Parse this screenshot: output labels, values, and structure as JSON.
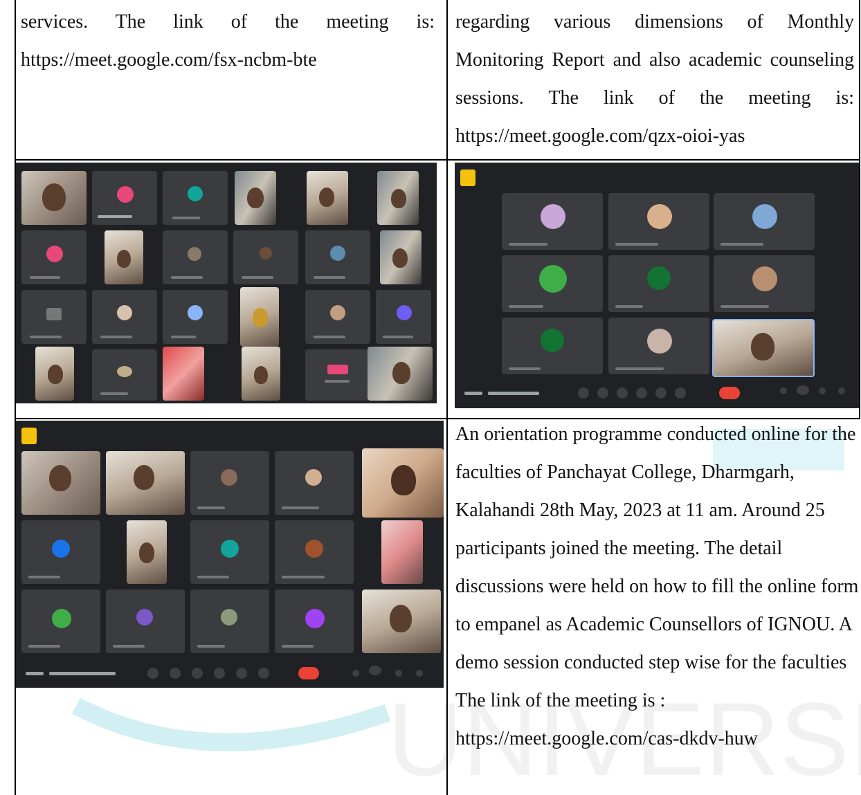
{
  "rows": [
    {
      "left_text": "services. The link of the meeting is: https://meet.google.com/fsx-ncbm-bte",
      "right_text": "regarding various dimensions of Monthly Monitoring Report and also academic counseling sessions. The link of the meeting is: https://meet.google.com/qzx-oioi-yas"
    },
    {
      "left_image": "meeting-screenshot-grid-24-participants",
      "right_image": "meeting-screenshot-grid-9-participants"
    },
    {
      "left_image": "meeting-screenshot-grid-15-participants",
      "right_text": "An orientation programme conducted online for the faculties of Panchayat College, Dharmgarh, Kalahandi 28th May, 2023 at 11 am. Around 25 participants joined the meeting. The detail discussions were held on how to fill the online form to empanel as Academic Counsellors of IGNOU. A demo session conducted step wise for the faculties The link of the meeting is : https://meet.google.com/cas-dkdv-huw"
    }
  ],
  "watermark": {
    "text": "UNIVERSITY",
    "color": "#bfe8f0"
  },
  "colors": {
    "meet_bg": "#1f2124",
    "tile": "#3a3c40",
    "pink": "#e8477a",
    "teal": "#12a59a",
    "green": "#3fae49",
    "blue": "#1a73e8",
    "purple": "#a142f4",
    "red": "#ea4335"
  }
}
